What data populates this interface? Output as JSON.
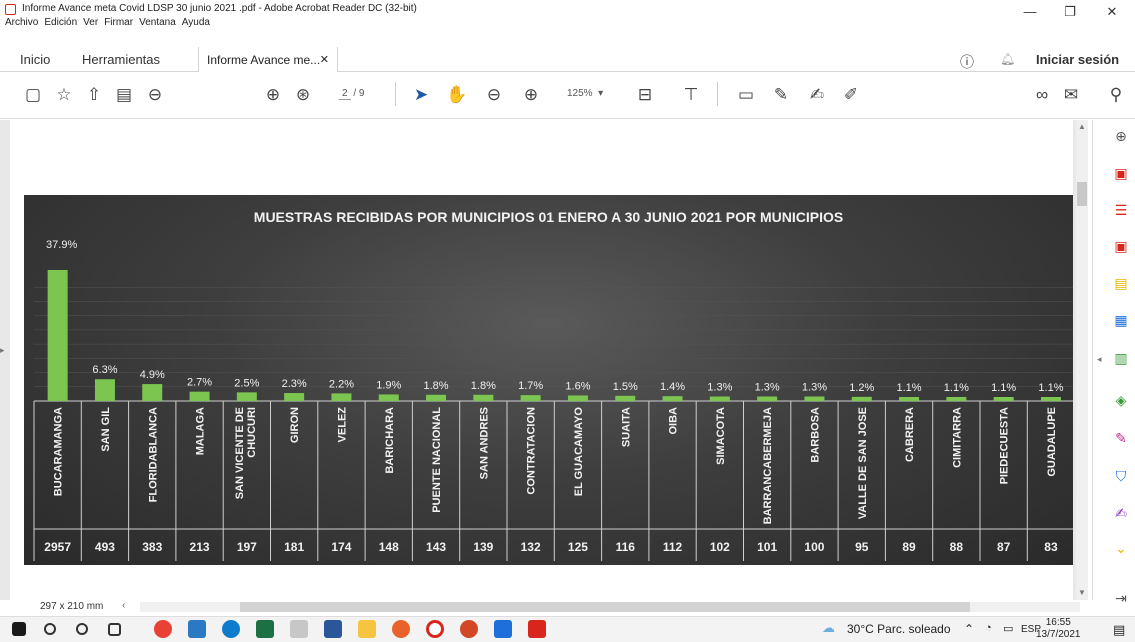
{
  "window": {
    "title": "Informe Avance meta Covid  LDSP 30 junio 2021 .pdf - Adobe Acrobat Reader DC (32-bit)",
    "menus": [
      "Archivo",
      "Edición",
      "Ver",
      "Firmar",
      "Ventana",
      "Ayuda"
    ]
  },
  "nav": {
    "home": "Inicio",
    "tools": "Herramientas",
    "doc_tab": "Informe Avance me...",
    "signin": "Iniciar sesión"
  },
  "toolbar": {
    "page_current": "2",
    "page_total": "/ 9",
    "zoom": "125%"
  },
  "status": {
    "page_size": "297 x 210 mm"
  },
  "taskbar": {
    "weather": "30°C  Parc. soleado",
    "lang": "ESP",
    "time": "16:55",
    "date": "13/7/2021"
  },
  "colors": {
    "bar": "#7cc551",
    "chart_bg": "#3a3a3a",
    "acrobat_red": "#d9261c"
  },
  "chart_data": {
    "type": "bar",
    "title": "MUESTRAS RECIBIDAS POR MUNICIPIOS 01 ENERO A  30 JUNIO 2021  POR MUNICIPIOS",
    "categories": [
      "BUCARAMANGA",
      "SAN GIL",
      "FLORIDABLANCA",
      "MALAGA",
      "SAN VICENTE DE CHUCURI",
      "GIRON",
      "VELEZ",
      "BARICHARA",
      "PUENTE NACIONAL",
      "SAN ANDRES",
      "CONTRATACION",
      "EL GUACAMAYO",
      "SUAITA",
      "OIBA",
      "SIMACOTA",
      "BARRANCABERMEJA",
      "BARBOSA",
      "VALLE DE SAN JOSE",
      "CABRERA",
      "CIMITARRA",
      "PIEDECUESTA",
      "GUADALUPE"
    ],
    "percent_labels": [
      "37.9%",
      "6.3%",
      "4.9%",
      "2.7%",
      "2.5%",
      "2.3%",
      "2.2%",
      "1.9%",
      "1.8%",
      "1.8%",
      "1.7%",
      "1.6%",
      "1.5%",
      "1.4%",
      "1.3%",
      "1.3%",
      "1.3%",
      "1.2%",
      "1.1%",
      "1.1%",
      "1.1%",
      "1.1%"
    ],
    "values": [
      37.9,
      6.3,
      4.9,
      2.7,
      2.5,
      2.3,
      2.2,
      1.9,
      1.8,
      1.8,
      1.7,
      1.6,
      1.5,
      1.4,
      1.3,
      1.3,
      1.3,
      1.2,
      1.1,
      1.1,
      1.1,
      1.1
    ],
    "counts": [
      "2957",
      "493",
      "383",
      "213",
      "197",
      "181",
      "174",
      "148",
      "143",
      "139",
      "132",
      "125",
      "116",
      "112",
      "102",
      "101",
      "100",
      "95",
      "89",
      "88",
      "87",
      "83"
    ],
    "ylim": [
      0,
      40
    ]
  }
}
